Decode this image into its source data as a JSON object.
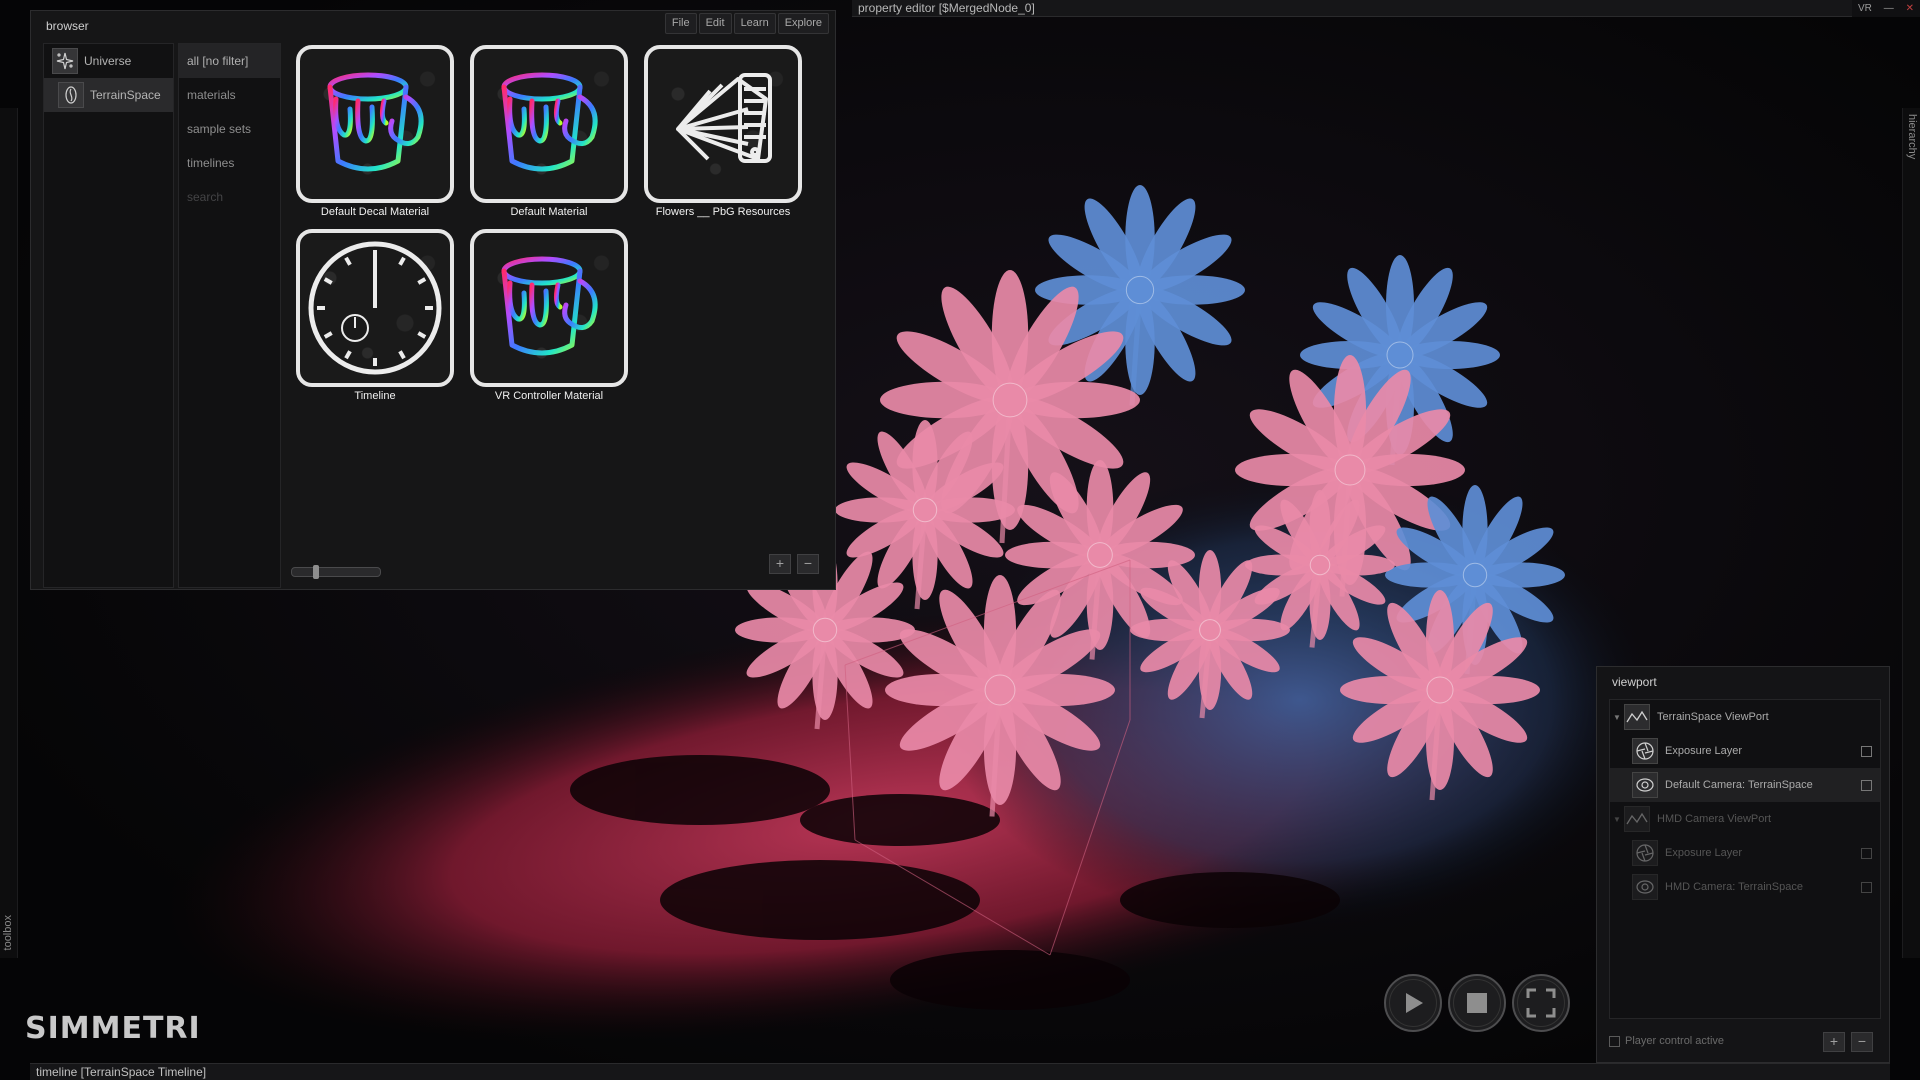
{
  "scene": {
    "accent_pink": "#e98aa8",
    "accent_blue": "#5e8ed6",
    "shadow_red": "#b2304a"
  },
  "property_editor": {
    "title": "property editor [$MergedNode_0]"
  },
  "window_controls": {
    "vr_label": "VR",
    "minimize": "—",
    "close": "✕"
  },
  "toolbox": {
    "label": "toolbox"
  },
  "hierarchy": {
    "label": "hierarchy"
  },
  "browser": {
    "title": "browser",
    "menu": [
      "File",
      "Edit",
      "Learn",
      "Explore"
    ],
    "spaces": [
      {
        "label": "Universe",
        "icon": "universe-icon"
      },
      {
        "label": "TerrainSpace",
        "icon": "terrain-space-icon"
      }
    ],
    "filters": [
      "all [no filter]",
      "materials",
      "sample sets",
      "timelines"
    ],
    "search_placeholder": "search",
    "assets": [
      {
        "label": "Default Decal Material",
        "icon": "paint-bucket-icon"
      },
      {
        "label": "Default Material",
        "icon": "paint-bucket-icon"
      },
      {
        "label": "Flowers __ PbG Resources",
        "icon": "swatch-fan-icon"
      },
      {
        "label": "Timeline",
        "icon": "clock-icon"
      },
      {
        "label": "VR Controller Material",
        "icon": "paint-bucket-icon"
      }
    ],
    "zoom_level": 0.25,
    "add_label": "+",
    "remove_label": "−"
  },
  "viewport": {
    "title": "viewport",
    "items": [
      {
        "label": "TerrainSpace ViewPort",
        "type": "group"
      },
      {
        "label": "Exposure Layer",
        "type": "child"
      },
      {
        "label": "Default Camera: TerrainSpace",
        "type": "child"
      },
      {
        "label": "HMD Camera ViewPort",
        "type": "group"
      },
      {
        "label": "Exposure Layer",
        "type": "child"
      },
      {
        "label": "HMD Camera: TerrainSpace",
        "type": "child"
      }
    ],
    "player_control": "Player control active",
    "add_label": "+",
    "remove_label": "−"
  },
  "transport": {
    "play": "play-icon",
    "stop": "stop-icon",
    "fullscreen": "fullscreen-icon"
  },
  "logo": {
    "text": "SIMMETRI"
  },
  "timeline": {
    "title": "timeline [TerrainSpace Timeline]"
  }
}
